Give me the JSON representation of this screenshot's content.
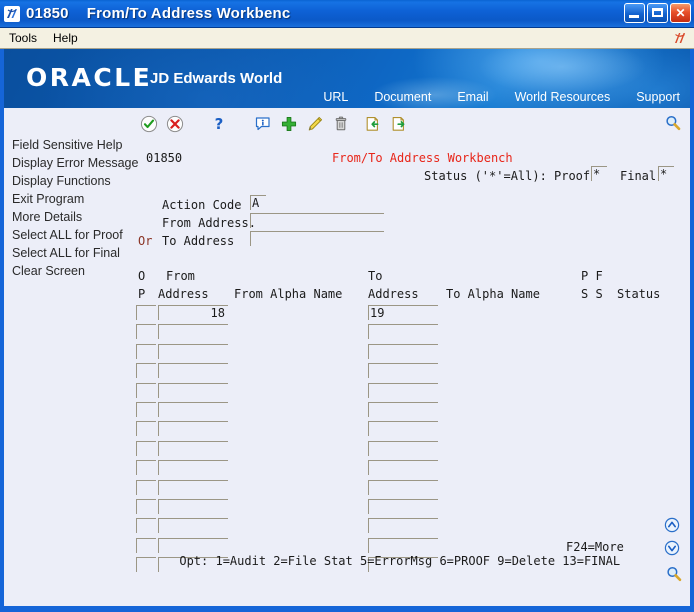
{
  "window": {
    "program_id": "01850",
    "title": "From/To Address Workbenc",
    "icon": "jde-app-icon",
    "buttons": {
      "minimize": "minimize-button",
      "maximize": "maximize-button",
      "close": "close-button"
    }
  },
  "menubar": {
    "items": [
      {
        "label": "Tools",
        "name": "menu-tools"
      },
      {
        "label": "Help",
        "name": "menu-help"
      }
    ],
    "logo_icon": "jde-logo-icon"
  },
  "banner": {
    "brand": "ORACLE",
    "product": "JD Edwards World",
    "links": [
      {
        "label": "URL",
        "name": "banner-link-url"
      },
      {
        "label": "Document",
        "name": "banner-link-document"
      },
      {
        "label": "Email",
        "name": "banner-link-email"
      },
      {
        "label": "World Resources",
        "name": "banner-link-world-resources"
      },
      {
        "label": "Support",
        "name": "banner-link-support"
      }
    ]
  },
  "toolbar": {
    "icons": [
      {
        "name": "accept-check-icon",
        "title": "OK / Enter"
      },
      {
        "name": "cancel-x-icon",
        "title": "Cancel"
      },
      {
        "name": "help-question-icon",
        "title": "Help"
      },
      {
        "name": "info-icon",
        "title": "Info"
      },
      {
        "name": "add-plus-icon",
        "title": "Add"
      },
      {
        "name": "edit-pencil-icon",
        "title": "Edit"
      },
      {
        "name": "delete-trash-icon",
        "title": "Delete"
      },
      {
        "name": "export-in-icon",
        "title": "Import"
      },
      {
        "name": "export-out-icon",
        "title": "Export"
      }
    ],
    "search_icon": "search-magnifier-icon"
  },
  "sidebar": {
    "items": [
      {
        "label": "Field Sensitive Help",
        "name": "sidebar-item-field-sensitive-help"
      },
      {
        "label": "Display Error Message",
        "name": "sidebar-item-display-error-message"
      },
      {
        "label": "Display Functions",
        "name": "sidebar-item-display-functions"
      },
      {
        "label": "Exit Program",
        "name": "sidebar-item-exit-program"
      },
      {
        "label": "More Details",
        "name": "sidebar-item-more-details"
      },
      {
        "label": "Select ALL for Proof",
        "name": "sidebar-item-select-all-for-proof"
      },
      {
        "label": "Select ALL for Final",
        "name": "sidebar-item-select-all-for-final"
      },
      {
        "label": "Clear Screen",
        "name": "sidebar-item-clear-screen"
      }
    ]
  },
  "form": {
    "screen_id": "01850",
    "screen_title": "From/To Address Workbench",
    "status_label": "Status ('*'=All):",
    "proof_label": "Proof",
    "proof_value": "*",
    "final_label": "Final",
    "final_value": "*",
    "action_code_label": "Action Code",
    "action_code_value": "A",
    "from_address_label": "From Address.",
    "from_address_value": "",
    "or_label": "Or",
    "to_address_label": "To Address",
    "to_address_value": ""
  },
  "grid": {
    "headers_line1": {
      "opt": "O",
      "from": "From",
      "to": "To",
      "ps": "P F"
    },
    "headers_line2": {
      "opt": "P",
      "from_address": "Address",
      "from_alpha": "From Alpha Name",
      "to_address": "Address",
      "to_alpha": "To Alpha Name",
      "ss": "S S",
      "status": "Status"
    },
    "rows": [
      {
        "opt": "",
        "from_address": "18",
        "from_alpha": "",
        "to_address": "19",
        "to_alpha": "",
        "ps": "",
        "fs": "",
        "status": ""
      },
      {
        "opt": "",
        "from_address": "",
        "from_alpha": "",
        "to_address": "",
        "to_alpha": "",
        "ps": "",
        "fs": "",
        "status": ""
      },
      {
        "opt": "",
        "from_address": "",
        "from_alpha": "",
        "to_address": "",
        "to_alpha": "",
        "ps": "",
        "fs": "",
        "status": ""
      },
      {
        "opt": "",
        "from_address": "",
        "from_alpha": "",
        "to_address": "",
        "to_alpha": "",
        "ps": "",
        "fs": "",
        "status": ""
      },
      {
        "opt": "",
        "from_address": "",
        "from_alpha": "",
        "to_address": "",
        "to_alpha": "",
        "ps": "",
        "fs": "",
        "status": ""
      },
      {
        "opt": "",
        "from_address": "",
        "from_alpha": "",
        "to_address": "",
        "to_alpha": "",
        "ps": "",
        "fs": "",
        "status": ""
      },
      {
        "opt": "",
        "from_address": "",
        "from_alpha": "",
        "to_address": "",
        "to_alpha": "",
        "ps": "",
        "fs": "",
        "status": ""
      },
      {
        "opt": "",
        "from_address": "",
        "from_alpha": "",
        "to_address": "",
        "to_alpha": "",
        "ps": "",
        "fs": "",
        "status": ""
      },
      {
        "opt": "",
        "from_address": "",
        "from_alpha": "",
        "to_address": "",
        "to_alpha": "",
        "ps": "",
        "fs": "",
        "status": ""
      },
      {
        "opt": "",
        "from_address": "",
        "from_alpha": "",
        "to_address": "",
        "to_alpha": "",
        "ps": "",
        "fs": "",
        "status": ""
      },
      {
        "opt": "",
        "from_address": "",
        "from_alpha": "",
        "to_address": "",
        "to_alpha": "",
        "ps": "",
        "fs": "",
        "status": ""
      },
      {
        "opt": "",
        "from_address": "",
        "from_alpha": "",
        "to_address": "",
        "to_alpha": "",
        "ps": "",
        "fs": "",
        "status": ""
      },
      {
        "opt": "",
        "from_address": "",
        "from_alpha": "",
        "to_address": "",
        "to_alpha": "",
        "ps": "",
        "fs": "",
        "status": ""
      },
      {
        "opt": "",
        "from_address": "",
        "from_alpha": "",
        "to_address": "",
        "to_alpha": "",
        "ps": "",
        "fs": "",
        "status": ""
      }
    ]
  },
  "rail": {
    "scroll_up_icon": "scroll-up-circle-icon",
    "scroll_down_icon": "scroll-down-circle-icon",
    "search_icon": "search-magnifier-icon"
  },
  "footer": {
    "options": "Opt: 1=Audit 2=File Stat 5=ErrorMsg 6=PROOF 9=Delete 13=FINAL",
    "more": "F24=More"
  },
  "colors": {
    "title_blue": "#0e62d6",
    "banner_blue": "#0b58ad",
    "screen_bg": "#eceef8",
    "title_red": "#e8261a",
    "maroon": "#8a3324",
    "menu_bg": "#f4f1e2",
    "field_border": "#9b9685"
  }
}
